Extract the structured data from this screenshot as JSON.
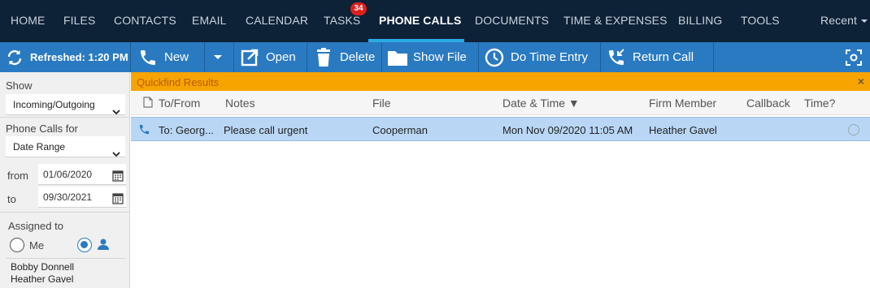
{
  "nav": {
    "items": [
      {
        "label": "HOME"
      },
      {
        "label": "FILES"
      },
      {
        "label": "CONTACTS"
      },
      {
        "label": "EMAIL"
      },
      {
        "label": "CALENDAR"
      },
      {
        "label": "TASKS"
      },
      {
        "label": "PHONE CALLS"
      },
      {
        "label": "DOCUMENTS"
      },
      {
        "label": "TIME & EXPENSES"
      },
      {
        "label": "BILLING"
      },
      {
        "label": "TOOLS"
      }
    ],
    "tasks_badge": "34",
    "recent_label": "Recent",
    "active": "PHONE CALLS"
  },
  "toolbar": {
    "refreshed_label": "Refreshed: 1:20 PM",
    "new_label": "New",
    "open_label": "Open",
    "delete_label": "Delete",
    "show_file_label": "Show File",
    "time_entry_label": "Do Time Entry",
    "return_call_label": "Return Call"
  },
  "filters": {
    "show_label": "Show",
    "show_value": "Incoming/Outgoing",
    "calls_for_label": "Phone Calls for",
    "calls_for_value": "Date Range",
    "from_label": "from",
    "from_value": "01/06/2020",
    "to_label": "to",
    "to_value": "09/30/2021",
    "assigned_label": "Assigned to",
    "me_label": "Me",
    "assigned_users": [
      "Bobby Donnell",
      "Heather Gavel"
    ]
  },
  "quickfind": {
    "label": "Quickfind Results",
    "close": "×"
  },
  "grid": {
    "columns": [
      "To/From",
      "Notes",
      "File",
      "Date & Time ▼",
      "Firm Member",
      "Callback",
      "Time?"
    ],
    "rows": [
      {
        "to_from": "To: Georg...",
        "notes": "Please call urgent",
        "file": "Cooperman",
        "datetime": "Mon Nov 09/2020 11:05 AM",
        "firm_member": "Heather Gavel",
        "callback": ""
      }
    ]
  },
  "colors": {
    "nav_bg": "#0d2137",
    "toolbar_bg": "#2a7ac2",
    "quickfind_bg": "#f7a400",
    "row_selected": "#b9d7f5",
    "accent": "#29abe2"
  }
}
